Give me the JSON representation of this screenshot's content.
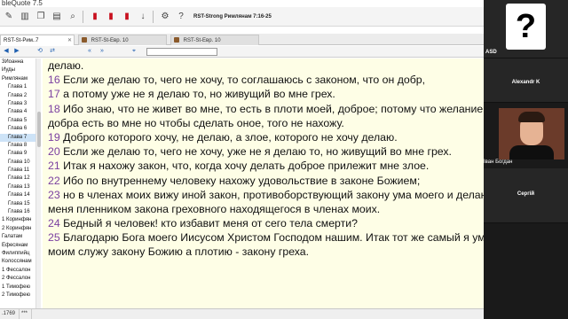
{
  "app": {
    "title": "bleQuote 7.5"
  },
  "toolbar": {
    "reference": "RST-Strong Римлянам 7:16-25",
    "icons": [
      "edit-icon",
      "columns-icon",
      "copy-icon",
      "paste-icon",
      "search-icon",
      "bookmark-icon",
      "bookmark-add-icon",
      "bookmark-remove-icon",
      "download-icon",
      "settings-icon",
      "help-icon"
    ]
  },
  "tabs": [
    {
      "label": "RST-St-Рим..7",
      "active": true
    },
    {
      "label": "RST-St-Евр. 10",
      "active": false
    },
    {
      "label": "RST-St-Евр. 10",
      "active": false
    }
  ],
  "sidebar": {
    "items": [
      {
        "label": "3Иоанна",
        "indent": false,
        "selected": false
      },
      {
        "label": "Иуды",
        "indent": false,
        "selected": false
      },
      {
        "label": "Римлянам",
        "indent": false,
        "selected": false
      },
      {
        "label": "Глава 1",
        "indent": true,
        "selected": false
      },
      {
        "label": "Глава 2",
        "indent": true,
        "selected": false
      },
      {
        "label": "Глава 3",
        "indent": true,
        "selected": false
      },
      {
        "label": "Глава 4",
        "indent": true,
        "selected": false
      },
      {
        "label": "Глава 5",
        "indent": true,
        "selected": false
      },
      {
        "label": "Глава 6",
        "indent": true,
        "selected": false
      },
      {
        "label": "Глава 7",
        "indent": true,
        "selected": true
      },
      {
        "label": "Глава 8",
        "indent": true,
        "selected": false
      },
      {
        "label": "Глава 9",
        "indent": true,
        "selected": false
      },
      {
        "label": "Глава 10",
        "indent": true,
        "selected": false
      },
      {
        "label": "Глава 11",
        "indent": true,
        "selected": false
      },
      {
        "label": "Глава 12",
        "indent": true,
        "selected": false
      },
      {
        "label": "Глава 13",
        "indent": true,
        "selected": false
      },
      {
        "label": "Глава 14",
        "indent": true,
        "selected": false
      },
      {
        "label": "Глава 15",
        "indent": true,
        "selected": false
      },
      {
        "label": "Глава 16",
        "indent": true,
        "selected": false
      },
      {
        "label": "1 Коринфян",
        "indent": false,
        "selected": false
      },
      {
        "label": "2 Коринфян",
        "indent": false,
        "selected": false
      },
      {
        "label": "Галатам",
        "indent": false,
        "selected": false
      },
      {
        "label": "Ефесянам",
        "indent": false,
        "selected": false
      },
      {
        "label": "Филиппийц",
        "indent": false,
        "selected": false
      },
      {
        "label": "Колоссянам",
        "indent": false,
        "selected": false
      },
      {
        "label": "1 Фессалон",
        "indent": false,
        "selected": false
      },
      {
        "label": "2 Фессалон",
        "indent": false,
        "selected": false
      },
      {
        "label": "1 Тимофею",
        "indent": false,
        "selected": false
      },
      {
        "label": "2 Тимофею",
        "indent": false,
        "selected": false
      }
    ]
  },
  "main": {
    "lines": [
      {
        "num": "",
        "text": "делаю."
      },
      {
        "num": "16",
        "text": " Если же делаю то, чего не хочу, то соглашаюсь с законом, что он добр,"
      },
      {
        "num": "17",
        "text": " а потому уже не я делаю то, но живущий во мне грех."
      },
      {
        "num": "18",
        "text": "  Ибо знаю, что не живет во мне, то есть в плоти моей, доброе; потому что желание"
      },
      {
        "num": "",
        "text": "добра есть во мне но чтобы сделать оное, того не нахожу."
      },
      {
        "num": "19",
        "text": " Доброго которого хочу, не делаю, а злое, которого не хочу делаю."
      },
      {
        "num": "20",
        "text": " Если же делаю то, чего не хочу, уже не я делаю то, но живущий во мне грех."
      },
      {
        "num": "21",
        "text": " Итак я нахожу закон, что, когда хочу делать доброе прилежит мне злое."
      },
      {
        "num": "22",
        "text": " Ибо по внутреннему человеку нахожу удовольствие в законе Божием;"
      },
      {
        "num": "23",
        "text": "  но в членах моих вижу иной закон, противоборствующий закону ума моего и делающий"
      },
      {
        "num": "",
        "text": "меня пленником закона греховного находящегося в членах моих."
      },
      {
        "num": "24",
        "text": " Бедный я человек! кто избавит меня от сего тела смерти?"
      },
      {
        "num": "25",
        "text": "  Благодарю Бога моего Иисусом Христом Господом нашим. Итак тот же самый я умом моим"
      },
      {
        "num": "",
        "text": "моим служу закону Божию а плотию - закону греха."
      }
    ]
  },
  "status": {
    "left": ".1769",
    "right": "***"
  },
  "video": {
    "participants": [
      {
        "name": "ASD"
      },
      {
        "name": "Alexandr K"
      },
      {
        "name": "Іван Богдан"
      },
      {
        "name": "Сергій"
      }
    ]
  }
}
